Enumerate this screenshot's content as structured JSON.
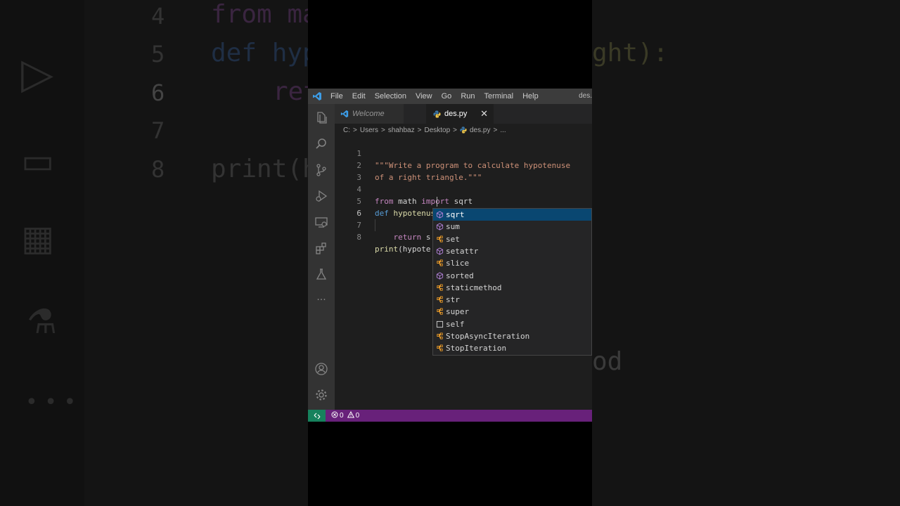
{
  "background": {
    "line_numbers": [
      "4",
      "5",
      "6",
      "7",
      "8"
    ],
    "ghost_code": [
      "from ma",
      "def hyp",
      "ret",
      "print(h",
      "ght):",
      "od"
    ]
  },
  "window": {
    "title": "des.",
    "menu": [
      "File",
      "Edit",
      "Selection",
      "View",
      "Go",
      "Run",
      "Terminal",
      "Help"
    ]
  },
  "activity_bar": {
    "icons": [
      "explorer-icon",
      "search-icon",
      "source-control-icon",
      "run-debug-icon",
      "remote-explorer-icon",
      "extensions-icon",
      "testing-icon",
      "more-icon",
      "account-icon",
      "settings-gear-icon"
    ]
  },
  "tabs": [
    {
      "label": "Welcome",
      "active": false
    },
    {
      "label": "des.py",
      "active": true,
      "close": "✕"
    }
  ],
  "breadcrumb": [
    "C:",
    "Users",
    "shahbaz",
    "Desktop",
    "des.py",
    "..."
  ],
  "breadcrumb_sep": ">",
  "editor": {
    "current_line": 6,
    "lines": [
      {
        "num": "1",
        "text": "\"\"\"Write a program to calculate hypotenuse"
      },
      {
        "num": "2",
        "text": "of a right triangle.\"\"\""
      },
      {
        "num": "3",
        "text": ""
      },
      {
        "num": "4",
        "text": "from math import sqrt"
      },
      {
        "num": "5",
        "text": "def hypotenuse(base, height):"
      },
      {
        "num": "6",
        "text": "    return s"
      },
      {
        "num": "7",
        "text": ""
      },
      {
        "num": "8",
        "text": "print(hypote"
      }
    ]
  },
  "suggestions": {
    "selected": "sqrt",
    "items": [
      {
        "label": "sqrt",
        "kind": "module-icon"
      },
      {
        "label": "sum",
        "kind": "module-icon"
      },
      {
        "label": "set",
        "kind": "class-icon"
      },
      {
        "label": "setattr",
        "kind": "module-icon"
      },
      {
        "label": "slice",
        "kind": "class-icon"
      },
      {
        "label": "sorted",
        "kind": "module-icon"
      },
      {
        "label": "staticmethod",
        "kind": "class-icon"
      },
      {
        "label": "str",
        "kind": "class-icon"
      },
      {
        "label": "super",
        "kind": "class-icon"
      },
      {
        "label": "self",
        "kind": "variable-icon"
      },
      {
        "label": "StopAsyncIteration",
        "kind": "class-icon"
      },
      {
        "label": "StopIteration",
        "kind": "class-icon"
      }
    ]
  },
  "status_bar": {
    "errors": "0",
    "warnings": "0"
  },
  "colors": {
    "status_bar": "#68217a",
    "remote": "#16825d",
    "selection": "#094771"
  }
}
